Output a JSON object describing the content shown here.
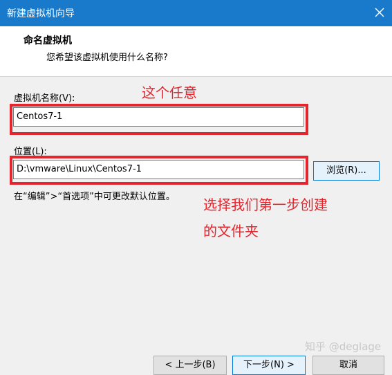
{
  "window": {
    "title": "新建虚拟机向导"
  },
  "header": {
    "title": "命名虚拟机",
    "subtitle": "您希望该虚拟机使用什么名称?"
  },
  "vm_name": {
    "label": "虚拟机名称(V):",
    "value": "Centos7-1"
  },
  "location": {
    "label": "位置(L):",
    "value": "D:\\vmware\\Linux\\Centos7-1",
    "browse_label": "浏览(R)...",
    "hint": "在“编辑”>“首选项”中可更改默认位置。"
  },
  "annotations": {
    "name_note": "这个任意",
    "location_note_line1": "选择我们第一步创建",
    "location_note_line2": "的文件夹",
    "color": "#e3262d"
  },
  "footer": {
    "back_label": "< 上一步(B)",
    "next_label": "下一步(N) >",
    "cancel_label": "取消"
  },
  "watermark": "知乎 @deglage",
  "colors": {
    "titlebar": "#1979ca",
    "dialog_bg": "#f0f0f0",
    "focus_border": "#0078d7"
  },
  "icons": {
    "close": "close-icon"
  }
}
